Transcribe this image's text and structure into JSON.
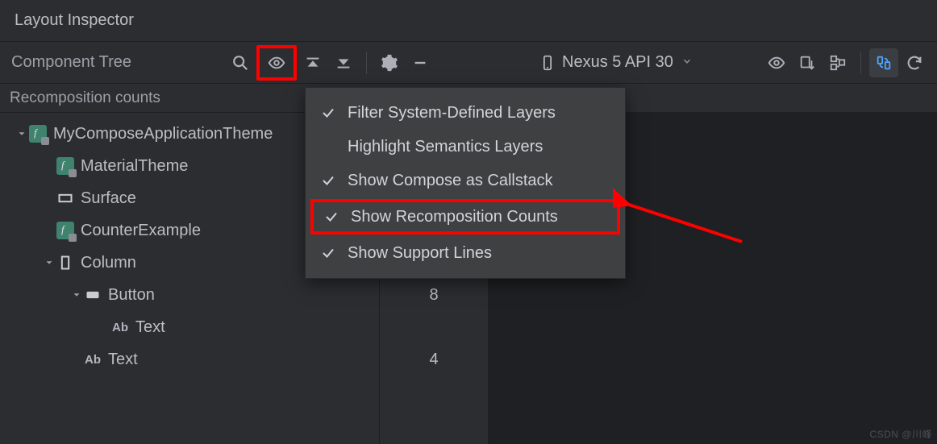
{
  "title": "Layout Inspector",
  "header_label": "Component Tree",
  "subheader": "Recomposition counts",
  "device_selector": {
    "label": "Nexus 5 API 30"
  },
  "toolbar": {
    "search_icon": "search",
    "visibility_icon": "eye",
    "collapse_icon": "collapse-top",
    "expand_icon": "expand-bottom",
    "settings_icon": "gear",
    "minimize_icon": "minimize"
  },
  "right_toolbar": {
    "visibility_icon": "eye",
    "export_icon": "export",
    "nav_icon": "nav-tree",
    "refresh_pair_icon": "refresh-pair",
    "refresh_icon": "refresh"
  },
  "menu": {
    "items": [
      {
        "checked": true,
        "label": "Filter System-Defined Layers"
      },
      {
        "checked": false,
        "label": "Highlight Semantics Layers"
      },
      {
        "checked": true,
        "label": "Show Compose as Callstack"
      },
      {
        "checked": true,
        "label": "Show Recomposition Counts",
        "highlighted": true
      },
      {
        "checked": true,
        "label": "Show Support Lines"
      }
    ]
  },
  "tree": [
    {
      "depth": 0,
      "expanded": true,
      "icon": "compose",
      "label": "MyComposeApplicationTheme",
      "count": null
    },
    {
      "depth": 1,
      "expanded": null,
      "icon": "compose",
      "label": "MaterialTheme",
      "count": null
    },
    {
      "depth": 1,
      "expanded": null,
      "icon": "rect",
      "label": "Surface",
      "count": null
    },
    {
      "depth": 1,
      "expanded": null,
      "icon": "compose",
      "label": "CounterExample",
      "count": null
    },
    {
      "depth": 1,
      "expanded": true,
      "icon": "rect-v",
      "label": "Column",
      "count": null
    },
    {
      "depth": 2,
      "expanded": true,
      "icon": "rect-f",
      "label": "Button",
      "count": 8
    },
    {
      "depth": 3,
      "expanded": null,
      "icon": "ab",
      "label": "Text",
      "count": null
    },
    {
      "depth": 2,
      "expanded": null,
      "icon": "ab",
      "label": "Text",
      "count": 4
    }
  ],
  "watermark": "CSDN @川峰"
}
